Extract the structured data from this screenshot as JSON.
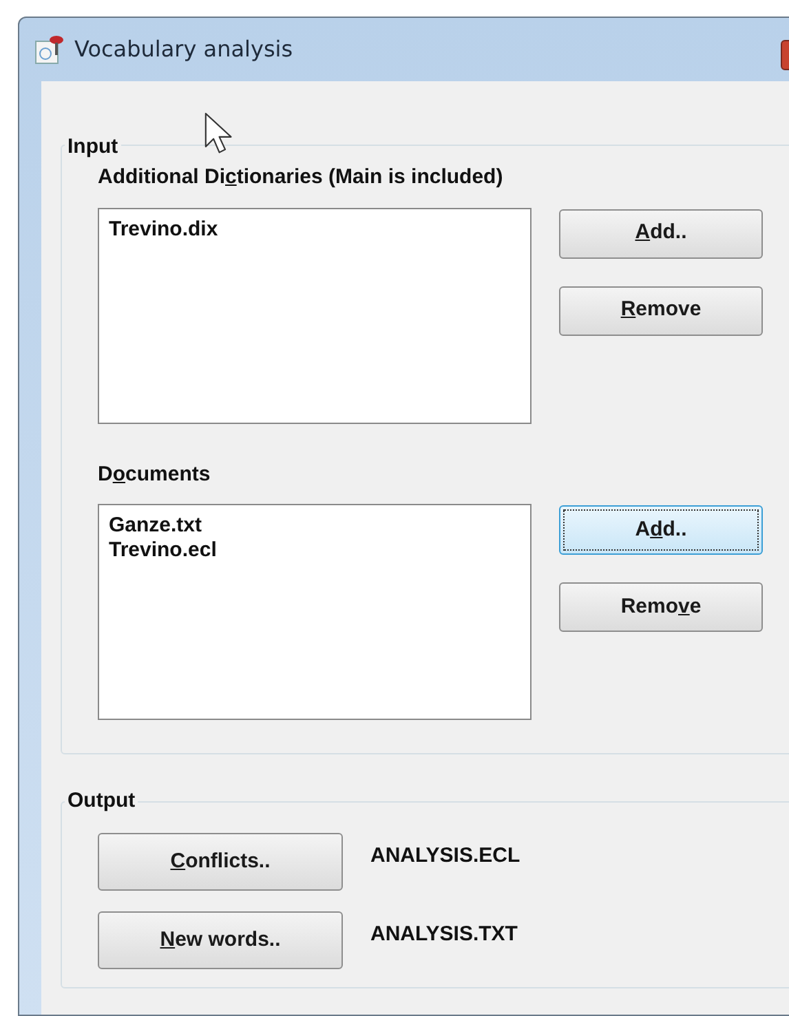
{
  "window": {
    "title": "Vocabulary analysis"
  },
  "input": {
    "title": "Input",
    "dictionaries": {
      "label": {
        "pre": "Additional Di",
        "key": "c",
        "post": "tionaries  (Main is included)"
      },
      "items": [
        "Trevino.dix"
      ],
      "buttons": [
        {
          "label": {
            "key": "A",
            "post": "dd.."
          },
          "focused": false
        },
        {
          "label": {
            "key": "R",
            "post": "emove"
          },
          "focused": false
        }
      ]
    },
    "documents": {
      "label": {
        "pre": "D",
        "key": "o",
        "post": "cuments"
      },
      "items": [
        "Ganze.txt",
        "Trevino.ecl"
      ],
      "buttons": [
        {
          "label": {
            "pre": "A",
            "key": "d",
            "post": "d.."
          },
          "focused": true
        },
        {
          "label": {
            "pre": "Remo",
            "key": "v",
            "post": "e"
          },
          "focused": false
        }
      ]
    }
  },
  "output": {
    "title": "Output",
    "rows": [
      {
        "button": {
          "label": {
            "key": "C",
            "post": "onflicts.."
          },
          "focused": false
        },
        "file": "ANALYSIS.ECL"
      },
      {
        "button": {
          "label": {
            "key": "N",
            "post": "ew words.."
          },
          "focused": false
        },
        "file": "ANALYSIS.TXT"
      }
    ]
  }
}
